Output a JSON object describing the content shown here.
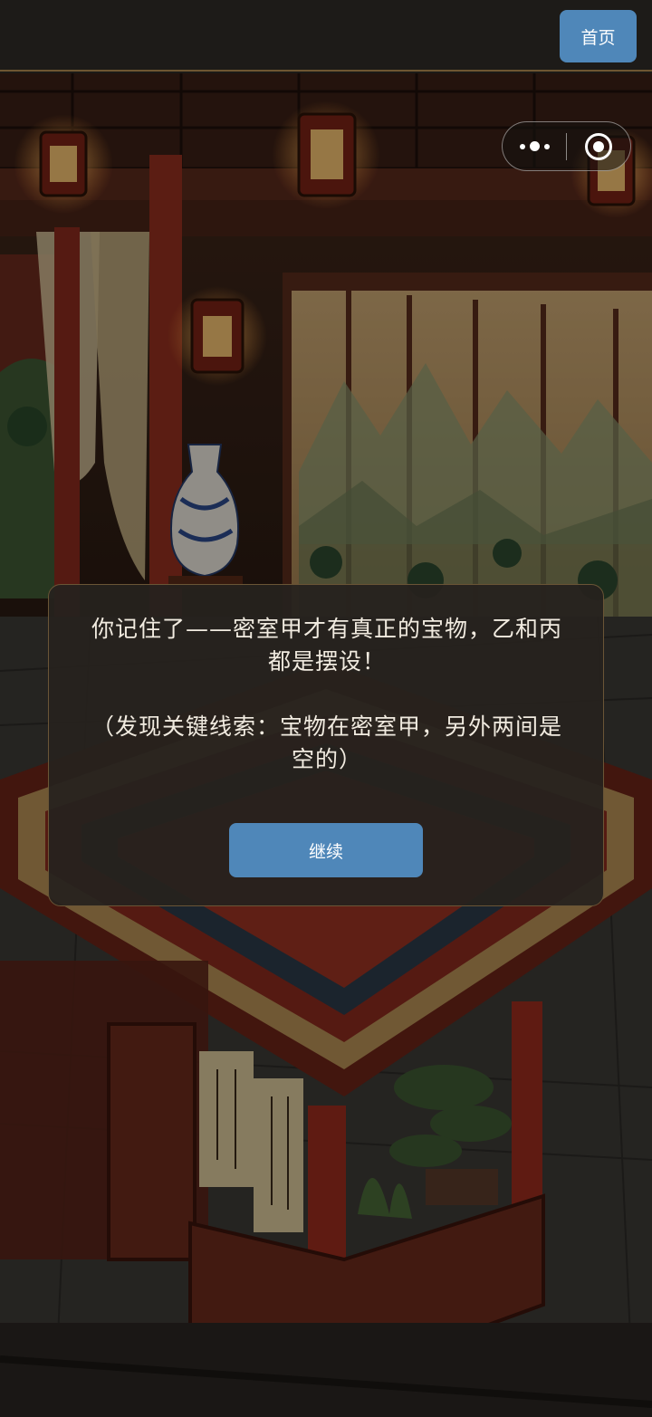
{
  "topbar": {
    "home_label": "首页"
  },
  "dialog": {
    "message_line1": "你记住了——密室甲才有真正的宝物，乙和丙",
    "message_line2": "都是摆设！",
    "clue_line1": "（发现关键线索：宝物在密室甲，另外两间是",
    "clue_line2": "空的）",
    "continue_label": "继续"
  },
  "colors": {
    "button": "#4f87b9",
    "dialog_bg": "#26221e",
    "lacquer_red": "#8a2a1e",
    "gold": "#c9a46a"
  },
  "icons": {
    "menu": "more-dots-icon",
    "close": "target-icon"
  }
}
